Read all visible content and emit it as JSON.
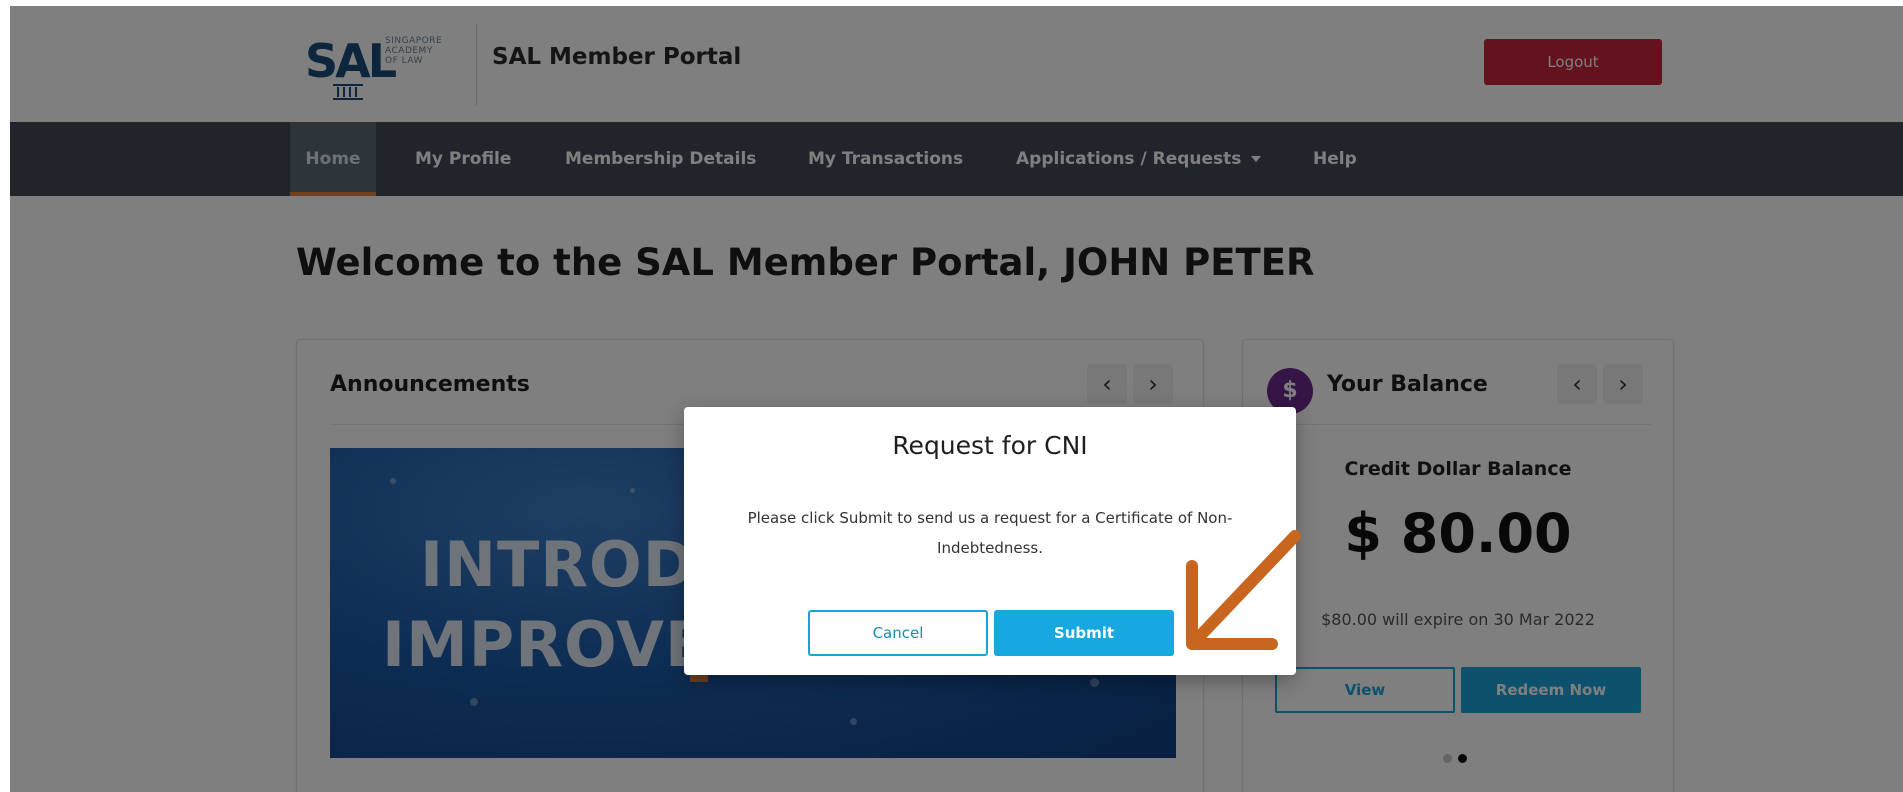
{
  "header": {
    "logo_mark": "SAL",
    "logo_sub_lines": [
      "SINGAPORE",
      "ACADEMY",
      "OF LAW"
    ],
    "portal_title": "SAL Member Portal",
    "logout_label": "Logout"
  },
  "nav": {
    "items": [
      "Home",
      "My Profile",
      "Membership Details",
      "My Transactions",
      "Applications / Requests",
      "Help"
    ]
  },
  "welcome": "Welcome to the SAL Member Portal, JOHN PETER",
  "announcements": {
    "title": "Announcements",
    "prev": "‹",
    "next": "›",
    "banner_line1": "INTRODUC",
    "banner_line2": "IMPROVED"
  },
  "balance": {
    "icon": "$",
    "title": "Your Balance",
    "prev": "‹",
    "next": "›",
    "subtitle": "Credit Dollar Balance",
    "amount": "$ 80.00",
    "expiry": "$80.00 will expire on 30 Mar 2022",
    "view_label": "View",
    "redeem_label": "Redeem Now"
  },
  "modal": {
    "title": "Request for CNI",
    "body": "Please click Submit to send us a request for a Certificate of Non-Indebtedness.",
    "cancel_label": "Cancel",
    "submit_label": "Submit"
  },
  "colors": {
    "nav_bg": "#3f4b57",
    "accent_orange": "#e0803a",
    "logout_red": "#c8253a",
    "primary_blue": "#18a8e0",
    "annotation_arrow": "#c8651e"
  }
}
